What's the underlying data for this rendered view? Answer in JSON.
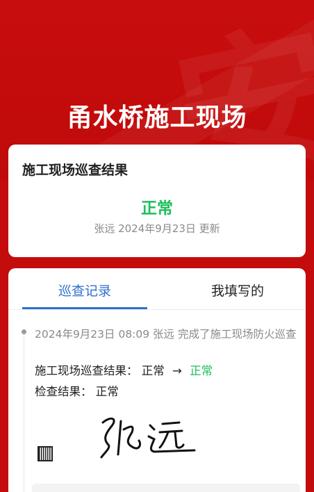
{
  "hero": {
    "title": "甬水桥施工现场"
  },
  "result": {
    "title": "施工现场巡查结果",
    "status": "正常",
    "meta": "张远 2024年9月23日 更新"
  },
  "tabs": [
    {
      "label": "巡查记录",
      "active": true
    },
    {
      "label": "我填写的",
      "active": false
    }
  ],
  "record": {
    "header": "2024年9月23日 08:09 张远 完成了施工现场防火巡查",
    "line1_label": "施工现场巡查结果：",
    "line1_old": "正常",
    "line1_arrow": "→",
    "line1_new": "正常",
    "line2_label": "检查结果：",
    "line2_value": "正常"
  },
  "colors": {
    "brand_red": "#c40c0c",
    "accent_blue": "#2f6fcf",
    "status_green": "#1cbf5b"
  }
}
